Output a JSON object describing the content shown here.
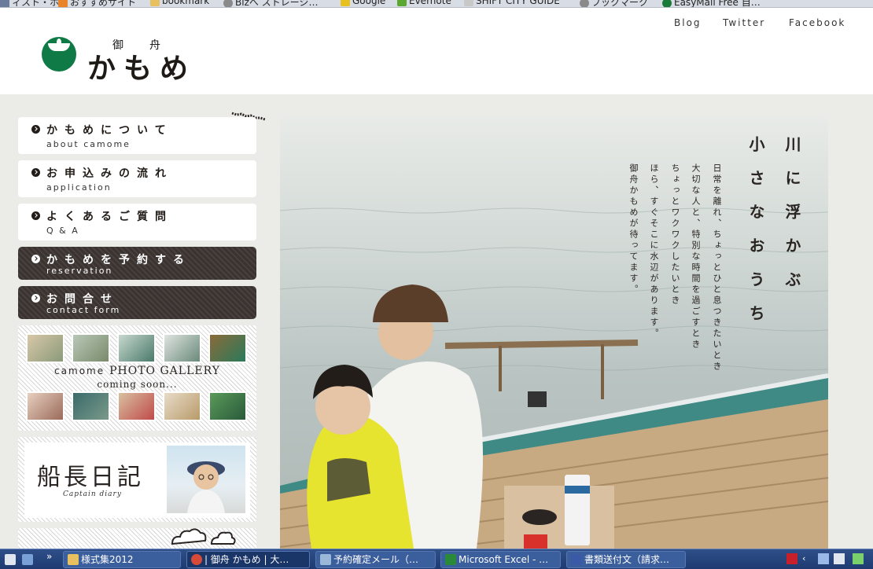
{
  "browser": {
    "bookmarks": [
      {
        "label": "ィスト・ホ…",
        "icon": "page-icon",
        "color": "#6b7b9a"
      },
      {
        "label": "おすすめサイト",
        "icon": "star-icon",
        "color": "#e8852a"
      },
      {
        "label": "bookmark",
        "icon": "folder-icon",
        "color": "#e8c060"
      },
      {
        "label": "Bizへ ストレージ…",
        "icon": "globe-icon",
        "color": "#8a8a8a"
      },
      {
        "label": "Google",
        "icon": "google-icon",
        "color": "#e8c020"
      },
      {
        "label": "Evernote",
        "icon": "evernote-icon",
        "color": "#5aa832"
      },
      {
        "label": "SHIFT CITY GUIDE",
        "icon": "page-icon",
        "color": "#c8c8c8"
      },
      {
        "label": "ブックマーク",
        "icon": "globe-icon",
        "color": "#8a8a8a"
      },
      {
        "label": "EasyMail Free 自…",
        "icon": "circle-icon",
        "color": "#1a7a3a"
      }
    ]
  },
  "header": {
    "logo_small_1": "御",
    "logo_small_2": "舟",
    "logo_text": "かもめ",
    "links": [
      "Blog",
      "Twitter",
      "Facebook"
    ],
    "brand_color": "#0f7a45"
  },
  "nav": [
    {
      "jp": "かもめについて",
      "en": "about camome",
      "style": "light"
    },
    {
      "jp": "お申込みの流れ",
      "en": "application",
      "style": "light"
    },
    {
      "jp": "よくあるご質問",
      "en": "Q & A",
      "style": "light"
    },
    {
      "jp": "かもめを予約する",
      "en": "reservation",
      "style": "dark"
    },
    {
      "jp": "お問合せ",
      "en": "contact form",
      "style": "dark"
    }
  ],
  "gallery": {
    "prefix": "camome",
    "title": "PHOTO GALLERY",
    "subtitle": "coming soon..."
  },
  "diary": {
    "title": "船長日記",
    "subtitle": "Captain diary"
  },
  "hero": {
    "headline": [
      "川に浮かぶ",
      "小さなおうち"
    ],
    "body": [
      "日常を離れ、ちょっとひと息つきたいとき",
      "大切な人と、特別な時間を過ごすとき",
      "ちょっとワクワクしたいとき",
      "ほら、すぐそこに水辺があります。",
      "御舟かもめが待ってます。"
    ]
  },
  "taskbar": {
    "tasks": [
      {
        "label": "様式集2012",
        "icon": "folder-icon",
        "color": "#e8c060"
      },
      {
        "label": "| 御舟 かもめ | 大…",
        "icon": "chrome-icon",
        "color": "#d84a38"
      },
      {
        "label": "予約確定メール（…",
        "icon": "notepad-icon",
        "color": "#9ab8d8"
      },
      {
        "label": "Microsoft Excel - …",
        "icon": "excel-icon",
        "color": "#2a8a3a"
      },
      {
        "label": "書類送付文（請求…",
        "icon": "word-icon",
        "color": "#3a5aa8"
      }
    ],
    "overflow": "»"
  }
}
